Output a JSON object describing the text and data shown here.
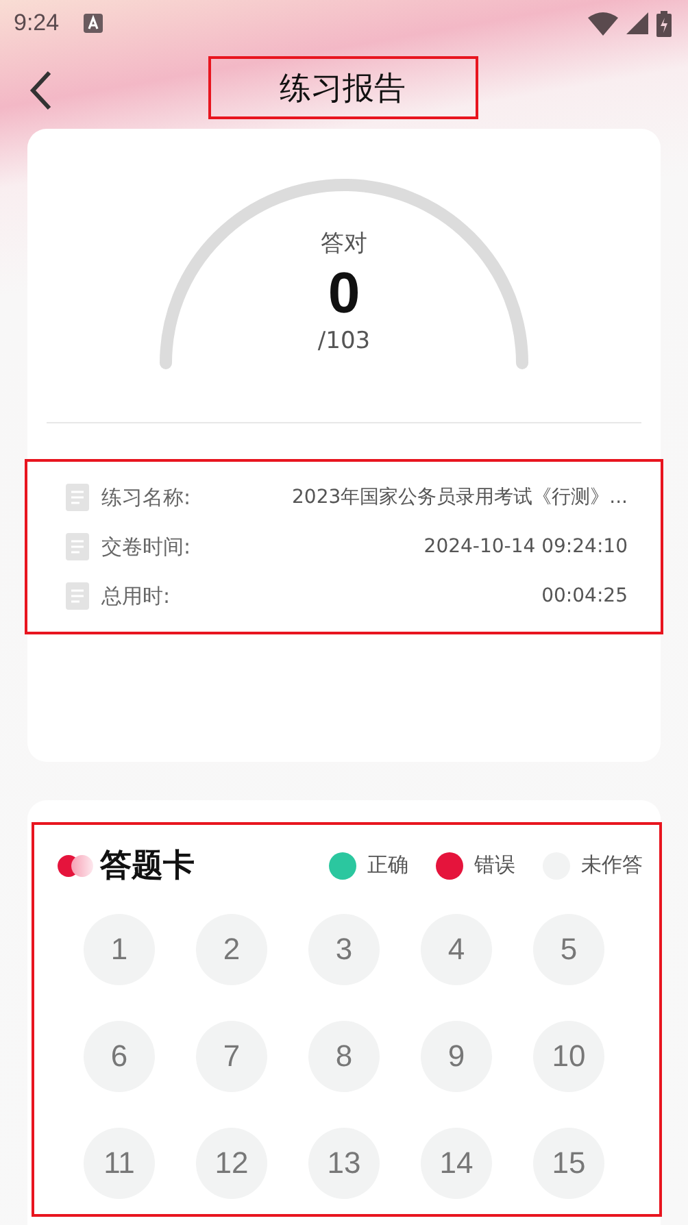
{
  "status_bar": {
    "time": "9:24"
  },
  "header": {
    "title": "练习报告"
  },
  "score": {
    "label": "答对",
    "value": "0",
    "total": "/103"
  },
  "info": [
    {
      "label": "练习名称:",
      "value": "2023年国家公务员录用考试《行测》..."
    },
    {
      "label": "交卷时间:",
      "value": "2024-10-14 09:24:10"
    },
    {
      "label": "总用时:",
      "value": "00:04:25"
    }
  ],
  "answer_card": {
    "title": "答题卡",
    "legend": [
      {
        "label": "正确",
        "color": "#2bc79f"
      },
      {
        "label": "错误",
        "color": "#e5143c"
      },
      {
        "label": "未作答",
        "color": "#f2f3f3"
      }
    ],
    "questions": [
      "1",
      "2",
      "3",
      "4",
      "5",
      "6",
      "7",
      "8",
      "9",
      "10",
      "11",
      "12",
      "13",
      "14",
      "15"
    ]
  }
}
